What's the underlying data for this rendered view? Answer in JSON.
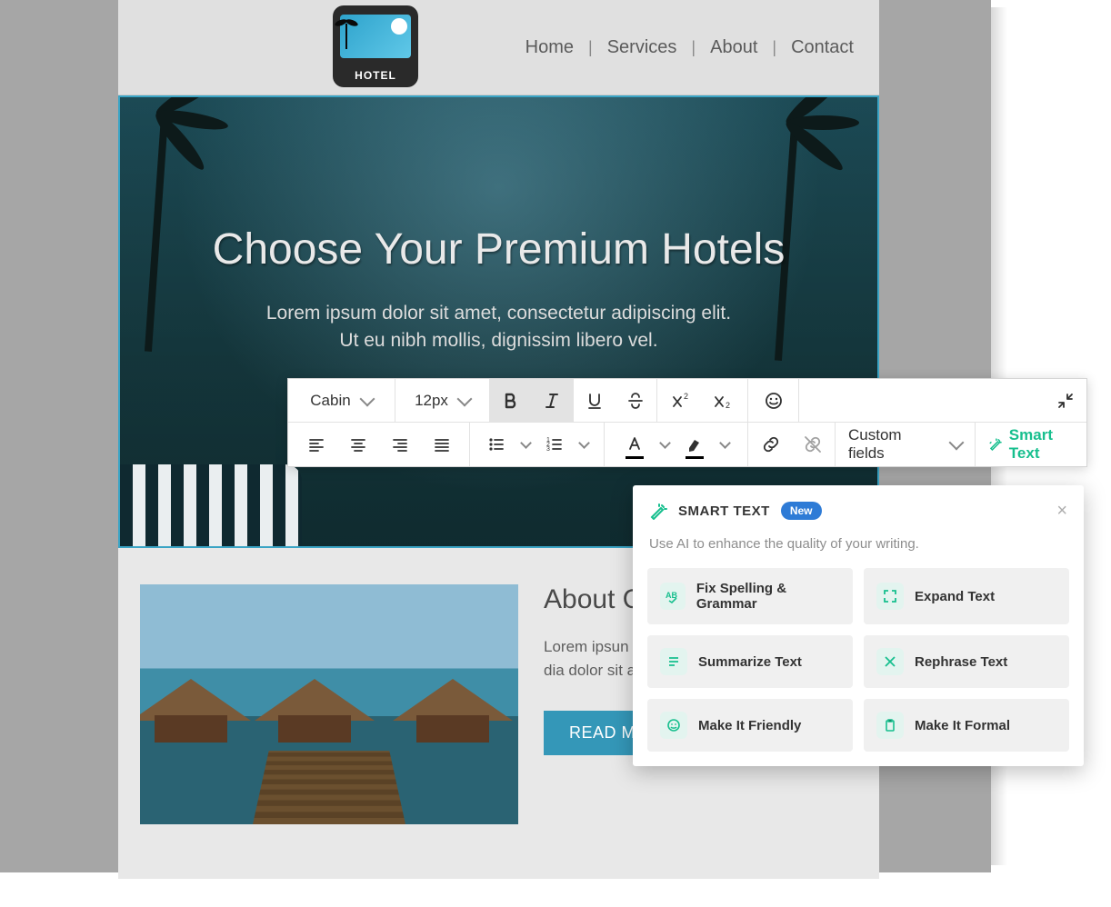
{
  "logo": {
    "label": "HOTEL"
  },
  "nav": {
    "items": [
      "Home",
      "Services",
      "About",
      "Contact"
    ]
  },
  "hero": {
    "title": "Choose Your Premium Hotels",
    "sub1": "Lorem ipsum dolor sit amet, consectetur adipiscing elit.",
    "sub2": "Ut eu nibh mollis, dignissim libero vel."
  },
  "toolbar": {
    "font": "Cabin",
    "size": "12px",
    "custom_fields": "Custom fields",
    "smart_text": "Smart Text"
  },
  "about": {
    "heading": "About O",
    "body": "Lorem ipsun adip iscin g euis. Loren elit,  se d dia dolor sit am",
    "button": "READ MORE"
  },
  "panel": {
    "title": "SMART TEXT",
    "badge": "New",
    "sub": "Use AI to enhance the quality of your writing.",
    "options": [
      "Fix Spelling & Grammar",
      "Expand Text",
      "Summarize Text",
      "Rephrase Text",
      "Make It Friendly",
      "Make It Formal"
    ]
  }
}
